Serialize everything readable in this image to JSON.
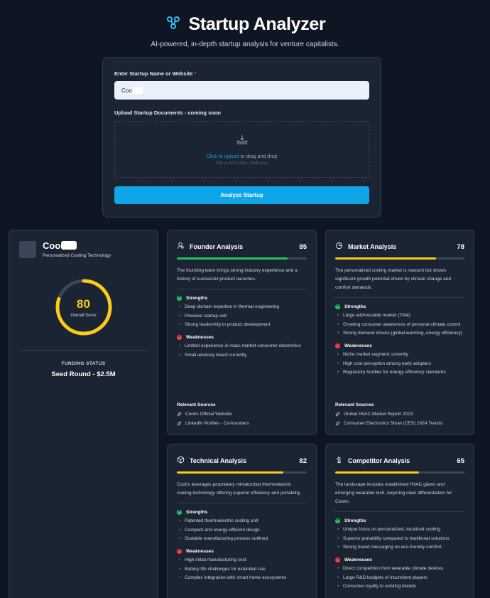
{
  "app": {
    "title": "Startup Analyzer",
    "subtitle": "AI-powered, in-depth startup analysis for venture capitalists.",
    "icon": "network-nodes-icon"
  },
  "form": {
    "name_label": "Enter Startup Name or Website",
    "required_mark": "*",
    "name_value": "Coo",
    "upload_label": "Upload Startup Documents - coming soon",
    "upload_link": "Click to upload",
    "upload_text": " or drag and drop",
    "upload_hint": "PDF or DOCX (Max. 25MB total)",
    "analyze_label": "Analyze Startup"
  },
  "company": {
    "name": "Coo",
    "tagline": "Personalized Cooling Technology",
    "overall_score": "80",
    "overall_score_fraction": 0.8,
    "overall_label": "Overall Score",
    "funding_label": "FUNDING STATUS",
    "funding_value": "Seed Round - $2.5M"
  },
  "colors": {
    "accent": "#0ea5e9",
    "score_yellow": "#facc15",
    "score_green": "#22c55e",
    "danger": "#ef4444"
  },
  "cards": {
    "founder": {
      "title": "Founder Analysis",
      "score": "85",
      "score_fraction": 0.85,
      "summary": "The founding team brings strong industry experience and a history of successful product launches.",
      "strengths_title": "Strengths",
      "strengths": [
        "Deep domain expertise in thermal engineering",
        "Previous startup exit",
        "Strong leadership in product development"
      ],
      "weaknesses_title": "Weaknesses",
      "weaknesses": [
        "Limited experience in mass market consumer electronics",
        "Small advisory board currently"
      ],
      "sources_title": "Relevant Sources",
      "sources": [
        "Coolrs Official Website",
        "LinkedIn Profiles - Co-founders"
      ]
    },
    "market": {
      "title": "Market Analysis",
      "score": "78",
      "score_fraction": 0.78,
      "summary": "The personalized cooling market is nascent but shows significant growth potential driven by climate change and comfort demands.",
      "strengths_title": "Strengths",
      "strengths": [
        "Large addressable market (TAM)",
        "Growing consumer awareness of personal climate control",
        "Strong demand drivers (global warming, energy efficiency)"
      ],
      "weaknesses_title": "Weaknesses",
      "weaknesses": [
        "Niche market segment currently",
        "High cost perception among early adopters",
        "Regulatory hurdles for energy efficiency standards"
      ],
      "sources_title": "Relevant Sources",
      "sources": [
        "Global HVAC Market Report 2023",
        "Consumer Electronics Show (CES) 2024 Trends"
      ]
    },
    "technical": {
      "title": "Technical Analysis",
      "score": "82",
      "score_fraction": 0.82,
      "summary": "Coolrs leverages proprietary miniaturized thermoelectric cooling technology offering superior efficiency and portability.",
      "strengths_title": "Strengths",
      "strengths": [
        "Patented thermoelectric cooling unit",
        "Compact and energy-efficient design",
        "Scalable manufacturing process outlined"
      ],
      "weaknesses_title": "Weaknesses",
      "weaknesses": [
        "High initial manufacturing cost",
        "Battery life challenges for extended use",
        "Complex integration with smart home ecosystems"
      ]
    },
    "competitor": {
      "title": "Competitor Analysis",
      "score": "65",
      "score_fraction": 0.65,
      "summary": "The landscape includes established HVAC giants and emerging wearable tech, requiring clear differentiation for Coolrs.",
      "strengths_title": "Strengths",
      "strengths": [
        "Unique focus on personalized, localized cooling",
        "Superior portability compared to traditional solutions",
        "Strong brand messaging on eco-friendly comfort"
      ],
      "weaknesses_title": "Weaknesses",
      "weaknesses": [
        "Direct competition from wearable climate devices",
        "Large R&D budgets of incumbent players",
        "Consumer loyalty to existing brands"
      ]
    }
  }
}
